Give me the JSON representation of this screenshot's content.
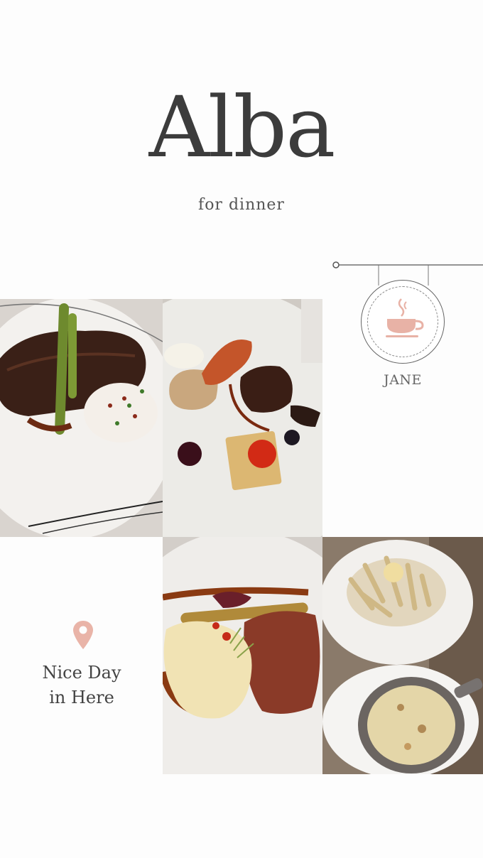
{
  "header": {
    "title": "Alba",
    "subtitle": "for dinner"
  },
  "badge": {
    "icon": "coffee-cup-icon",
    "label": "JANE",
    "accent_color": "#e8b2a6"
  },
  "location": {
    "icon": "location-pin-icon",
    "line1": "Nice Day",
    "line2": "in Here",
    "pin_color": "#e9b4a8"
  },
  "photos": [
    {
      "name": "steak-with-asparagus-photo"
    },
    {
      "name": "shrimp-and-beef-plate-photo"
    },
    {
      "name": "pork-with-mashed-potato-photo"
    },
    {
      "name": "pasta-and-gratin-photo"
    }
  ]
}
